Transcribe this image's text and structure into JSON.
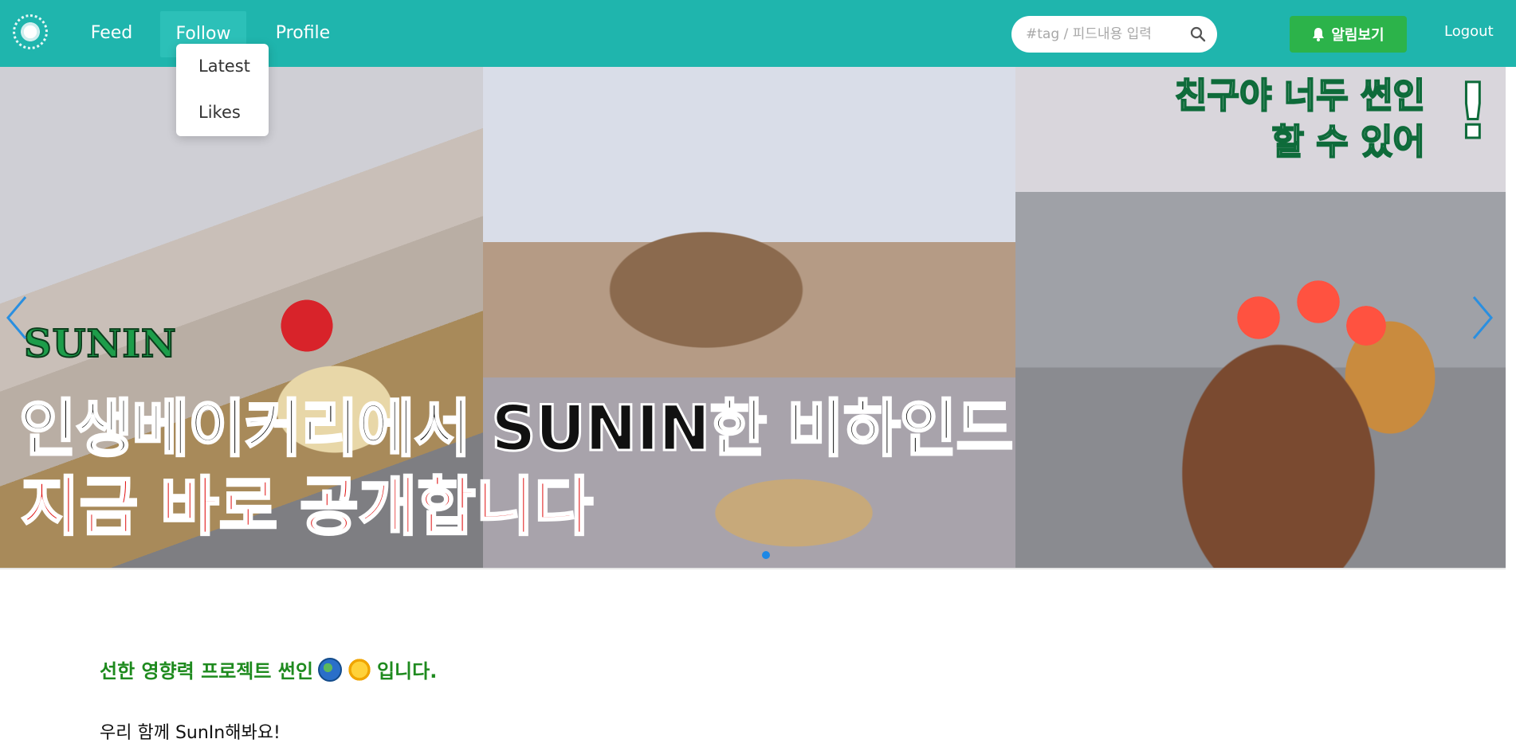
{
  "navbar": {
    "nav": {
      "feed": "Feed",
      "follow": "Follow",
      "profile": "Profile"
    },
    "follow_dropdown": {
      "latest": "Latest",
      "likes": "Likes"
    },
    "search": {
      "placeholder": "#tag / 피드내용 입력",
      "icon": "search-icon"
    },
    "notify_label": "알림보기",
    "logout_label": "Logout"
  },
  "banner": {
    "brand_text": "SUNIN",
    "headline_line1": "인생베이커리에서 SUNIN한 비하인드",
    "headline_line2": "지금 바로 공개합니다",
    "side_caption_line1": "친구야 너두 썬인",
    "side_caption_line2": "할 수 있어",
    "side_caption_mark": "!"
  },
  "content": {
    "intro_before": "선한 영향력 프로젝트 썬인",
    "intro_after": "입니다.",
    "together": "우리 함께 SunIn해봐요!"
  },
  "colors": {
    "navbar": "#1fb5ad",
    "notify_button": "#2cb34a",
    "intro_text": "#1e8a1e"
  }
}
